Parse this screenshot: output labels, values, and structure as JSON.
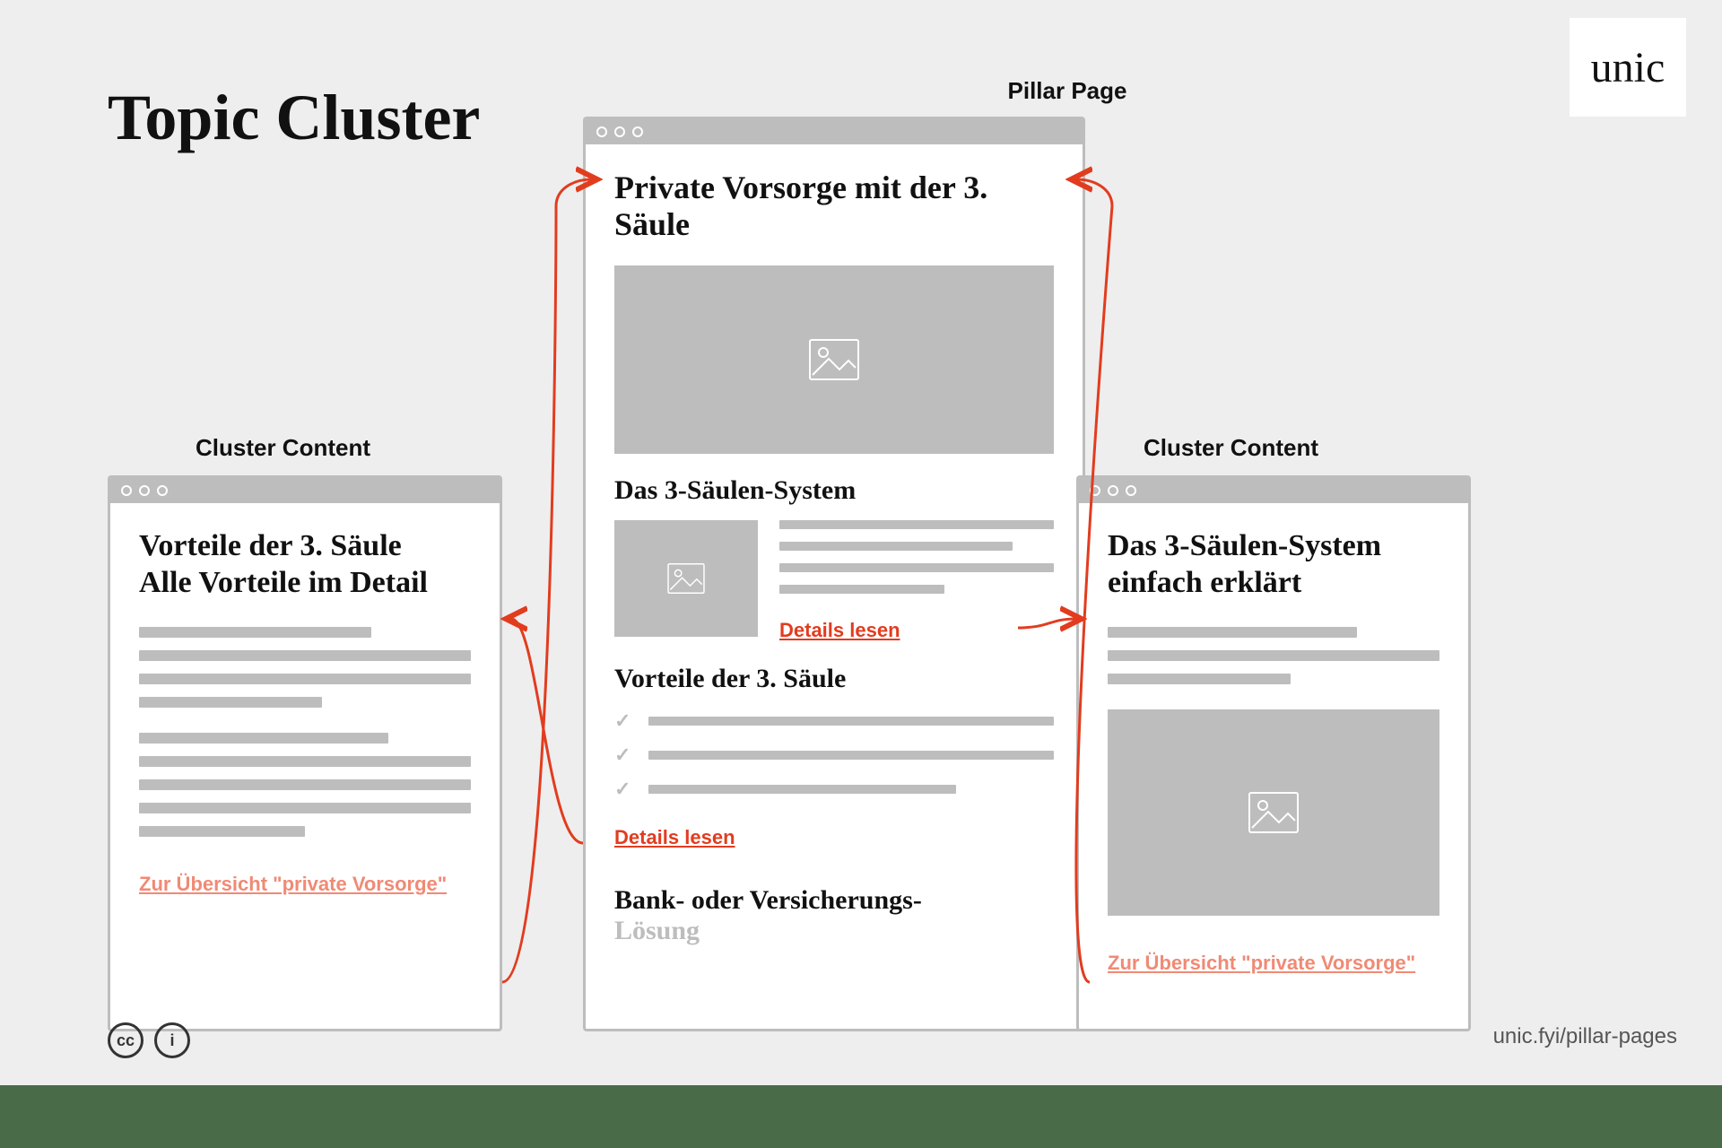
{
  "meta": {
    "title": "Topic Cluster",
    "logo_text": "unic",
    "footer_url": "unic.fyi/pillar-pages",
    "license_cc": "cc",
    "license_by": "i"
  },
  "labels": {
    "pillar": "Pillar Page",
    "cluster_left": "Cluster Content",
    "cluster_right": "Cluster Content"
  },
  "pillar": {
    "title": "Private Vorsorge mit der 3. Säule",
    "section1_title": "Das 3-Säulen-System",
    "section1_link": "Details lesen",
    "section2_title": "Vorteile der 3. Säule",
    "section2_link": "Details lesen",
    "section3_title_line1": "Bank- oder Versicherungs-",
    "section3_title_line2": "Lösung"
  },
  "cluster_left": {
    "title_line1": "Vorteile der 3. Säule",
    "title_line2": "Alle Vorteile im Detail",
    "back_link": "Zur Übersicht \"private Vorsorge\""
  },
  "cluster_right": {
    "title_line1": "Das 3-Säulen-System",
    "title_line2": "einfach erklärt",
    "back_link": "Zur Übersicht \"private Vorsorge\""
  },
  "colors": {
    "accent": "#e23c1f",
    "placeholder": "#bdbdbd",
    "bg": "#eeeeee",
    "green": "#4a6b48"
  }
}
